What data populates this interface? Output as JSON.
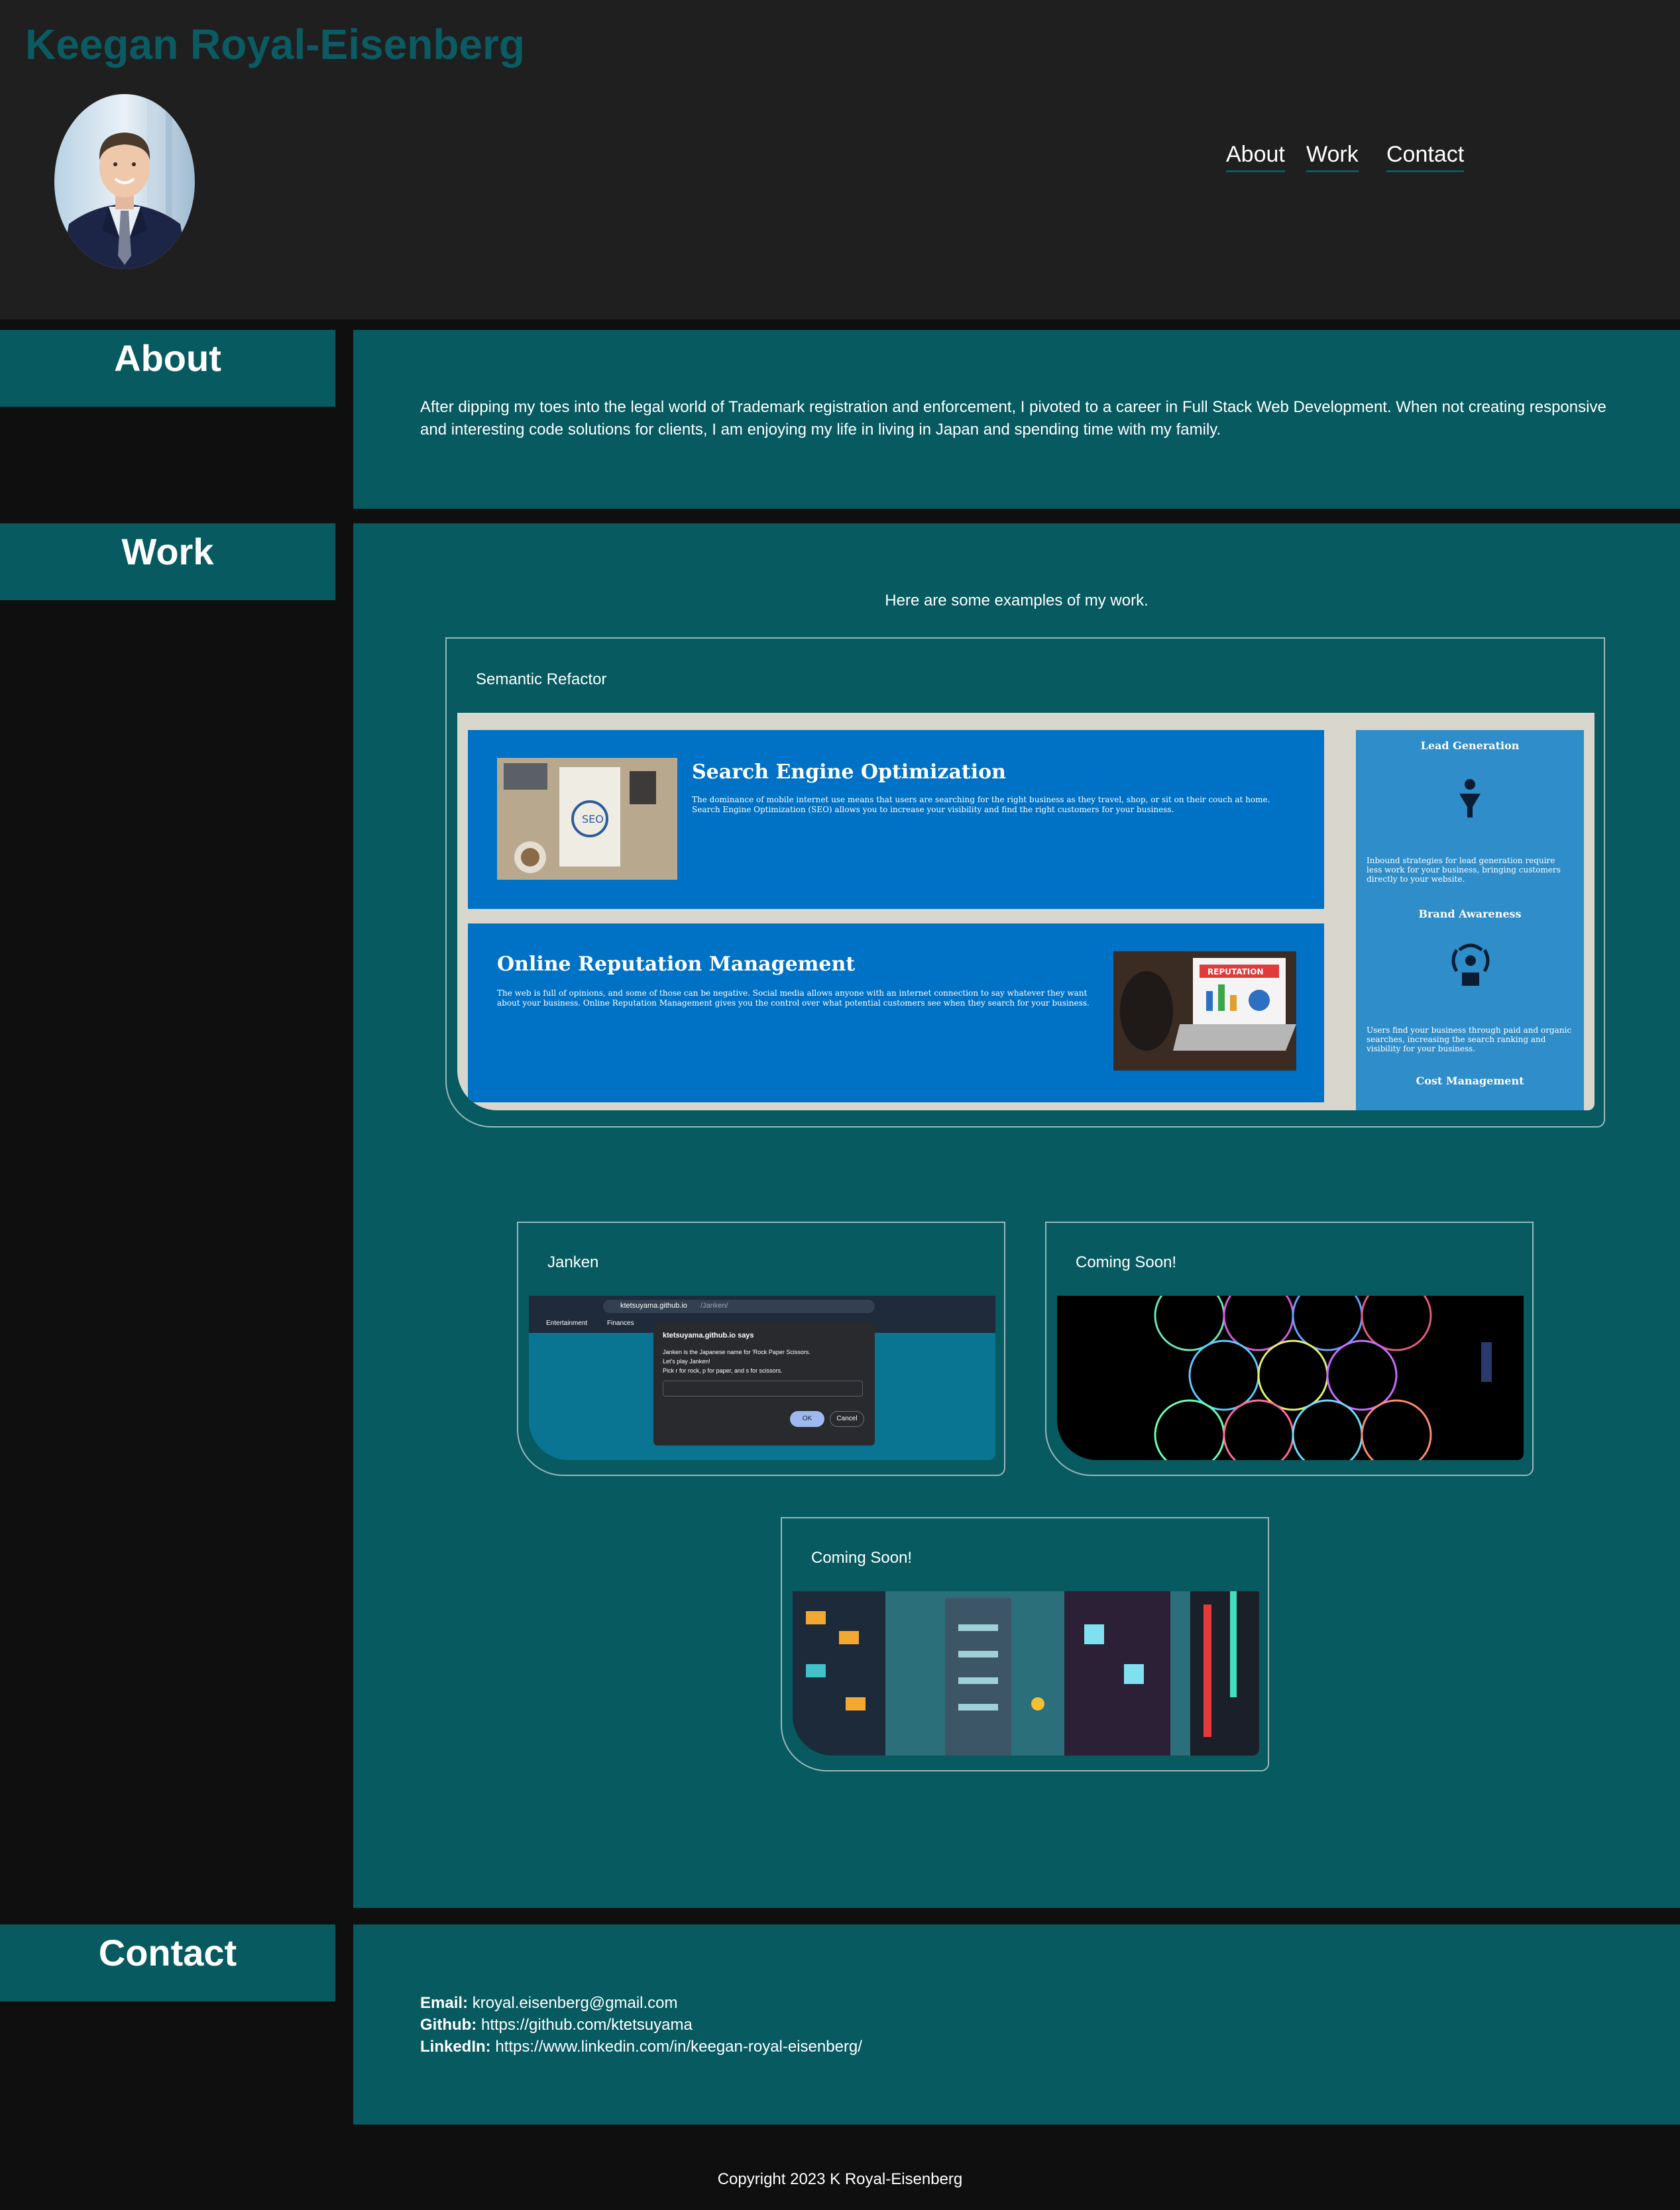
{
  "header": {
    "title": "Keegan Royal-Eisenberg",
    "nav": {
      "about": "About",
      "work": "Work",
      "contact": "Contact"
    }
  },
  "about": {
    "heading": "About",
    "text": "After dipping my toes into the legal world of Trademark registration and enforcement, I pivoted to a career in Full Stack Web Development. When not creating responsive and interesting code solutions for clients, I am enjoying my life in living in Japan and spending time with my family."
  },
  "work": {
    "heading": "Work",
    "intro": "Here are some examples of my work.",
    "projects": [
      {
        "title": "Semantic Refactor",
        "screenshot": {
          "seo_heading": "Search Engine Optimization",
          "seo_text": "The dominance of mobile internet use means that users are searching for the right business as they travel, shop, or sit on their couch at home. Search Engine Optimization (SEO) allows you to increase your visibility and find the right customers for your business.",
          "orm_heading": "Online Reputation Management",
          "orm_text": "The web is full of opinions, and some of those can be negative. Social media allows anyone with an internet connection to say whatever they want about your business. Online Reputation Management gives you the control over what potential customers see when they search for your business.",
          "side_lead": "Lead Generation",
          "side_lead_text": "Inbound strategies for lead generation require less work for your business, bringing customers directly to your website.",
          "side_brand": "Brand Awareness",
          "side_brand_text": "Users find your business through paid and organic searches, increasing the search ranking and visibility for your business.",
          "side_cost": "Cost Management",
          "seo_badge": "SEO",
          "rep_badge": "REPUTATION"
        }
      },
      {
        "title": "Janken",
        "screenshot": {
          "url_host": "ktetsuyama.github.io",
          "url_path": "/Janken/",
          "bookmark1": "Entertainment",
          "bookmark2": "Finances",
          "dialog_title": "ktetsuyama.github.io says",
          "dialog_line1": "Janken is the Japanese name for 'Rock Paper Scissors.",
          "dialog_line2": "Let's play Janken!",
          "dialog_line3": "Pick r for rock, p for paper, and s for scissors.",
          "ok": "OK",
          "cancel": "Cancel"
        }
      },
      {
        "title": "Coming Soon!"
      },
      {
        "title": "Coming Soon!"
      }
    ]
  },
  "contact": {
    "heading": "Contact",
    "email_label": "Email:",
    "email": "kroyal.eisenberg@gmail.com",
    "github_label": "Github:",
    "github": "https://github.com/ktetsuyama",
    "linkedin_label": "LinkedIn:",
    "linkedin": "https://www.linkedin.com/in/keegan-royal-eisenberg/"
  },
  "footer": {
    "copyright": "Copyright 2023 K Royal-Eisenberg"
  },
  "colors": {
    "header_bg": "#1f1f1f",
    "page_bg": "#0f0f0f",
    "teal": "#065a60",
    "title_teal": "#0b5b63",
    "card_border": "#9ab8bb"
  }
}
